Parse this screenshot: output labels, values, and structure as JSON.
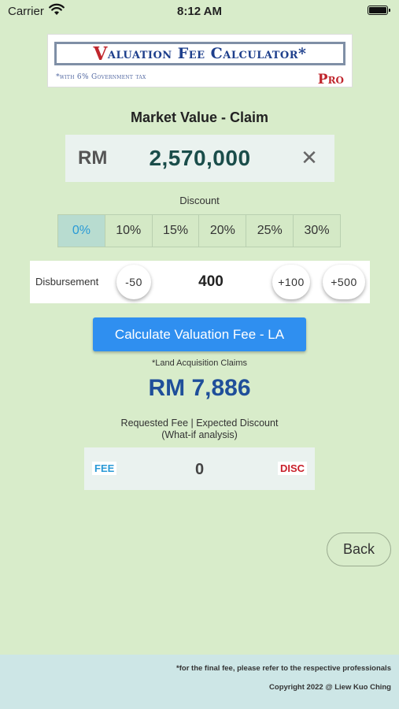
{
  "status_bar": {
    "carrier": "Carrier",
    "time": "8:12 AM",
    "battery_level": 1.0
  },
  "logo": {
    "title_first_letter": "V",
    "title_rest": "aluation Fee Calculator*",
    "subtitle": "*with 6% Government tax",
    "edition": "Pro"
  },
  "section_title": "Market Value - Claim",
  "market_value": {
    "currency": "RM",
    "amount": "2,570,000"
  },
  "discount": {
    "label": "Discount",
    "options": [
      "0%",
      "10%",
      "15%",
      "20%",
      "25%",
      "30%"
    ],
    "selected": "0%"
  },
  "disbursement": {
    "label": "Disbursement",
    "minus": "-50",
    "value": "400",
    "plus_small": "+100",
    "plus_large": "+500"
  },
  "calculate_button": "Calculate Valuation Fee - LA",
  "la_note": "*Land Acquisition Claims",
  "result": "RM 7,886",
  "whatif": {
    "line1": "Requested Fee | Expected Discount",
    "line2": "(What-if analysis)"
  },
  "fee_box": {
    "fee_tag": "FEE",
    "value": "0",
    "disc_tag": "DISC"
  },
  "back_button": "Back",
  "footer": {
    "note": "*for the final fee, please refer to the respective professionals",
    "copyright": "Copyright 2022 @ Liew Kuo Ching"
  },
  "colors": {
    "background": "#d8ecca",
    "accent_blue": "#2f8ff0",
    "result_blue": "#1f4f9a",
    "segment_active": "#b8dcd0",
    "footer": "#cde6e6"
  }
}
